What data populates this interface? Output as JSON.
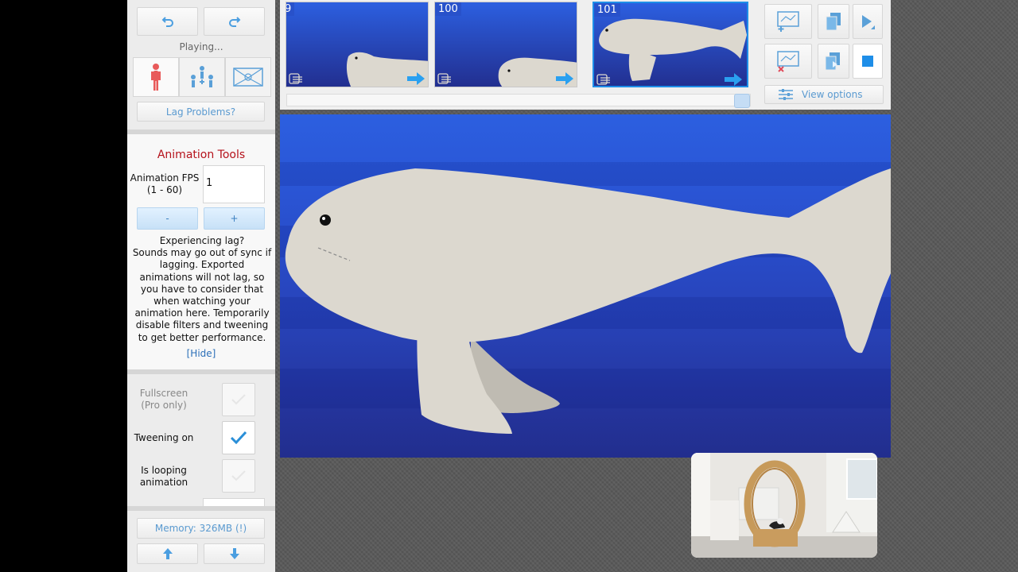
{
  "left_panel": {
    "status": "Playing...",
    "lag_problems_button": "Lag Problems?",
    "animation_tools": {
      "title": "Animation Tools",
      "fps_label_line1": "Animation FPS",
      "fps_label_line2": "(1 - 60)",
      "fps_value": "1",
      "minus": "-",
      "plus": "+",
      "lag_heading": "Experiencing lag?",
      "lag_text": "Sounds may go out of sync if lagging. Exported animations will not lag, so you have to consider that when watching your animation here. Temporarily disable filters and tweening to get better performance.",
      "hide_link": "[Hide]"
    },
    "options": {
      "fullscreen_line1": "Fullscreen",
      "fullscreen_line2": "(Pro only)",
      "tweening": "Tweening on",
      "looping_line1": "Is looping",
      "looping_line2": "animation"
    },
    "memory": "Memory: 326MB (!)"
  },
  "timeline": {
    "frames": [
      {
        "number": "9"
      },
      {
        "number": "100"
      },
      {
        "number": "101"
      }
    ]
  },
  "top_right": {
    "view_options": "View options"
  },
  "colors": {
    "accent": "#3b8fd8",
    "title_red": "#b5121b",
    "whale": "#dcd8cf",
    "ocean_top": "#2c5fe0",
    "ocean_bottom": "#222e8e"
  }
}
